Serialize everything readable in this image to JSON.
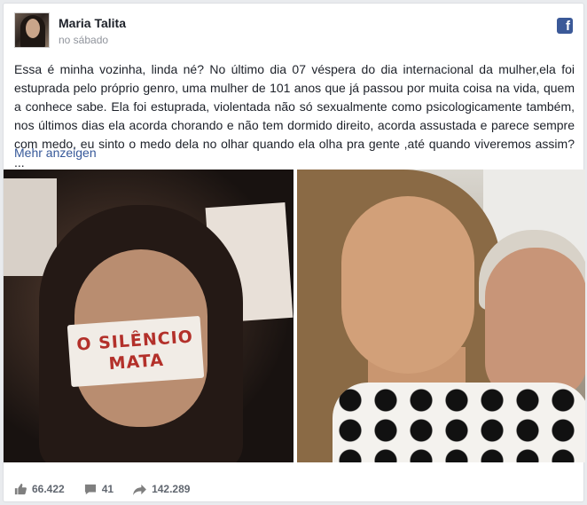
{
  "post": {
    "author": "Maria Talita",
    "time": "no sábado",
    "text": "Essa é minha vozinha, linda né? No último dia 07 véspera do dia internacional da mulher,ela foi estuprada pelo próprio genro, uma mulher de 101 anos que já passou por muita coisa na vida, quem a conhece sabe. Ela foi estuprada, violentada não só sexualmente como psicologicamente também, nos últimos dias ela acorda chorando e não tem dormido direito, acorda assustada e parece sempre com medo, eu sinto o medo dela no olhar quando ela olha pra gente ,até quando viveremos assim? ...",
    "more_label": "Mehr anzeigen",
    "tape_line1": "O SILÊNCIO",
    "tape_line2": "MATA"
  },
  "stats": {
    "likes": "66.422",
    "comments": "41",
    "shares": "142.289"
  },
  "icons": {
    "brand": "facebook-icon",
    "like": "thumbs-up-icon",
    "comment": "comment-icon",
    "share": "share-arrow-icon"
  },
  "colors": {
    "link": "#365899",
    "facebook_blue": "#3b5998",
    "meta_gray": "#90949c"
  }
}
